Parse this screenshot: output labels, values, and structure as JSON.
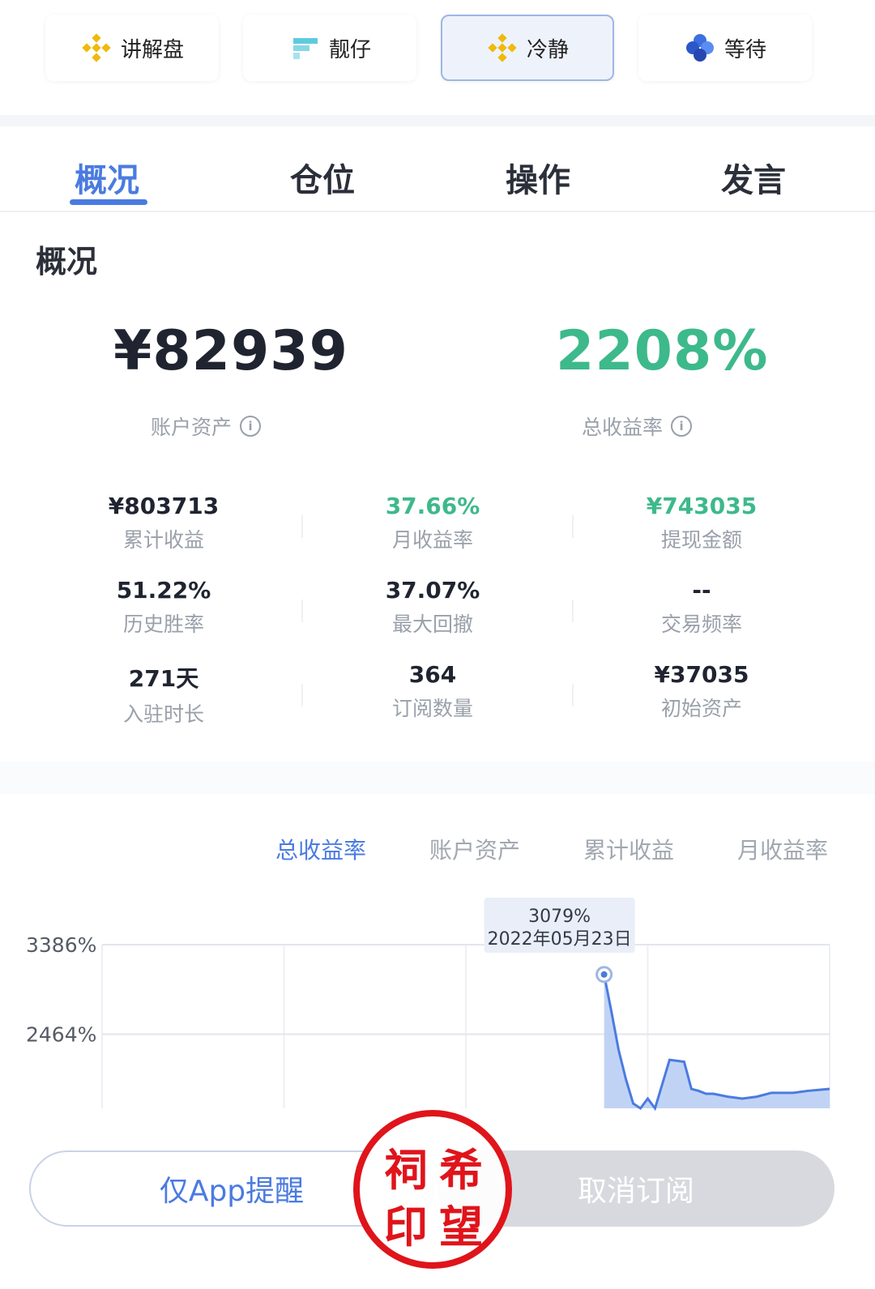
{
  "exchanges": [
    {
      "label": "讲解盘",
      "icon": "binance-diamond-icon"
    },
    {
      "label": "靓仔",
      "icon": "ftx-icon"
    },
    {
      "label": "冷静",
      "icon": "binance-diamond-icon",
      "active": true
    },
    {
      "label": "等待",
      "icon": "blue-clover-icon"
    }
  ],
  "tabs": [
    {
      "label": "概况",
      "active": true
    },
    {
      "label": "仓位"
    },
    {
      "label": "操作"
    },
    {
      "label": "发言"
    }
  ],
  "section_title": "概况",
  "summary": {
    "account_assets": {
      "value": "¥82939",
      "label": "账户资产"
    },
    "total_return": {
      "value": "2208%",
      "label": "总收益率"
    }
  },
  "stats": [
    {
      "value": "¥803713",
      "label": "累计收益",
      "color": "default"
    },
    {
      "value": "37.66%",
      "label": "月收益率",
      "color": "green"
    },
    {
      "value": "¥743035",
      "label": "提现金额",
      "color": "green"
    },
    {
      "value": "51.22%",
      "label": "历史胜率",
      "color": "default"
    },
    {
      "value": "37.07%",
      "label": "最大回撤",
      "color": "default"
    },
    {
      "value": "--",
      "label": "交易频率",
      "color": "default"
    },
    {
      "value": "271天",
      "label": "入驻时长",
      "color": "default"
    },
    {
      "value": "364",
      "label": "订阅数量",
      "color": "default"
    },
    {
      "value": "¥37035",
      "label": "初始资产",
      "color": "default"
    }
  ],
  "chart_tabs": [
    {
      "label": "总收益率",
      "active": true
    },
    {
      "label": "账户资产"
    },
    {
      "label": "累计收益"
    },
    {
      "label": "月收益率"
    }
  ],
  "chart_data": {
    "type": "area",
    "ytick_labels": [
      "3386%",
      "2464%"
    ],
    "yticks": [
      3386,
      2464
    ],
    "ylim": [
      1700,
      3386
    ],
    "x": [
      0,
      0.25,
      0.42,
      0.48,
      0.5,
      0.52,
      0.55,
      0.6,
      0.66,
      0.69,
      0.7,
      0.71,
      0.72,
      0.73,
      0.74,
      0.75,
      0.76,
      0.78,
      0.8,
      0.81,
      0.82,
      0.83,
      0.84,
      0.86,
      0.88,
      0.9,
      0.92,
      0.95,
      0.97,
      1.0
    ],
    "values": [
      null,
      null,
      null,
      null,
      null,
      null,
      null,
      null,
      null,
      3079,
      2700,
      2300,
      2000,
      1750,
      1700,
      1800,
      1700,
      2200,
      2180,
      1900,
      1880,
      1850,
      1850,
      1820,
      1800,
      1820,
      1860,
      1860,
      1880,
      1900
    ],
    "tooltip": {
      "value": "3079%",
      "date": "2022年05月23日"
    },
    "color": "#4a7be0"
  },
  "buttons": {
    "app_alert": "仅App提醒",
    "unsubscribe": "取消订阅"
  },
  "stamp_chars": [
    "祠",
    "希",
    "印",
    "望"
  ],
  "colors": {
    "accent": "#4a7be0",
    "green": "#3db98b",
    "stamp": "#e0141b"
  }
}
